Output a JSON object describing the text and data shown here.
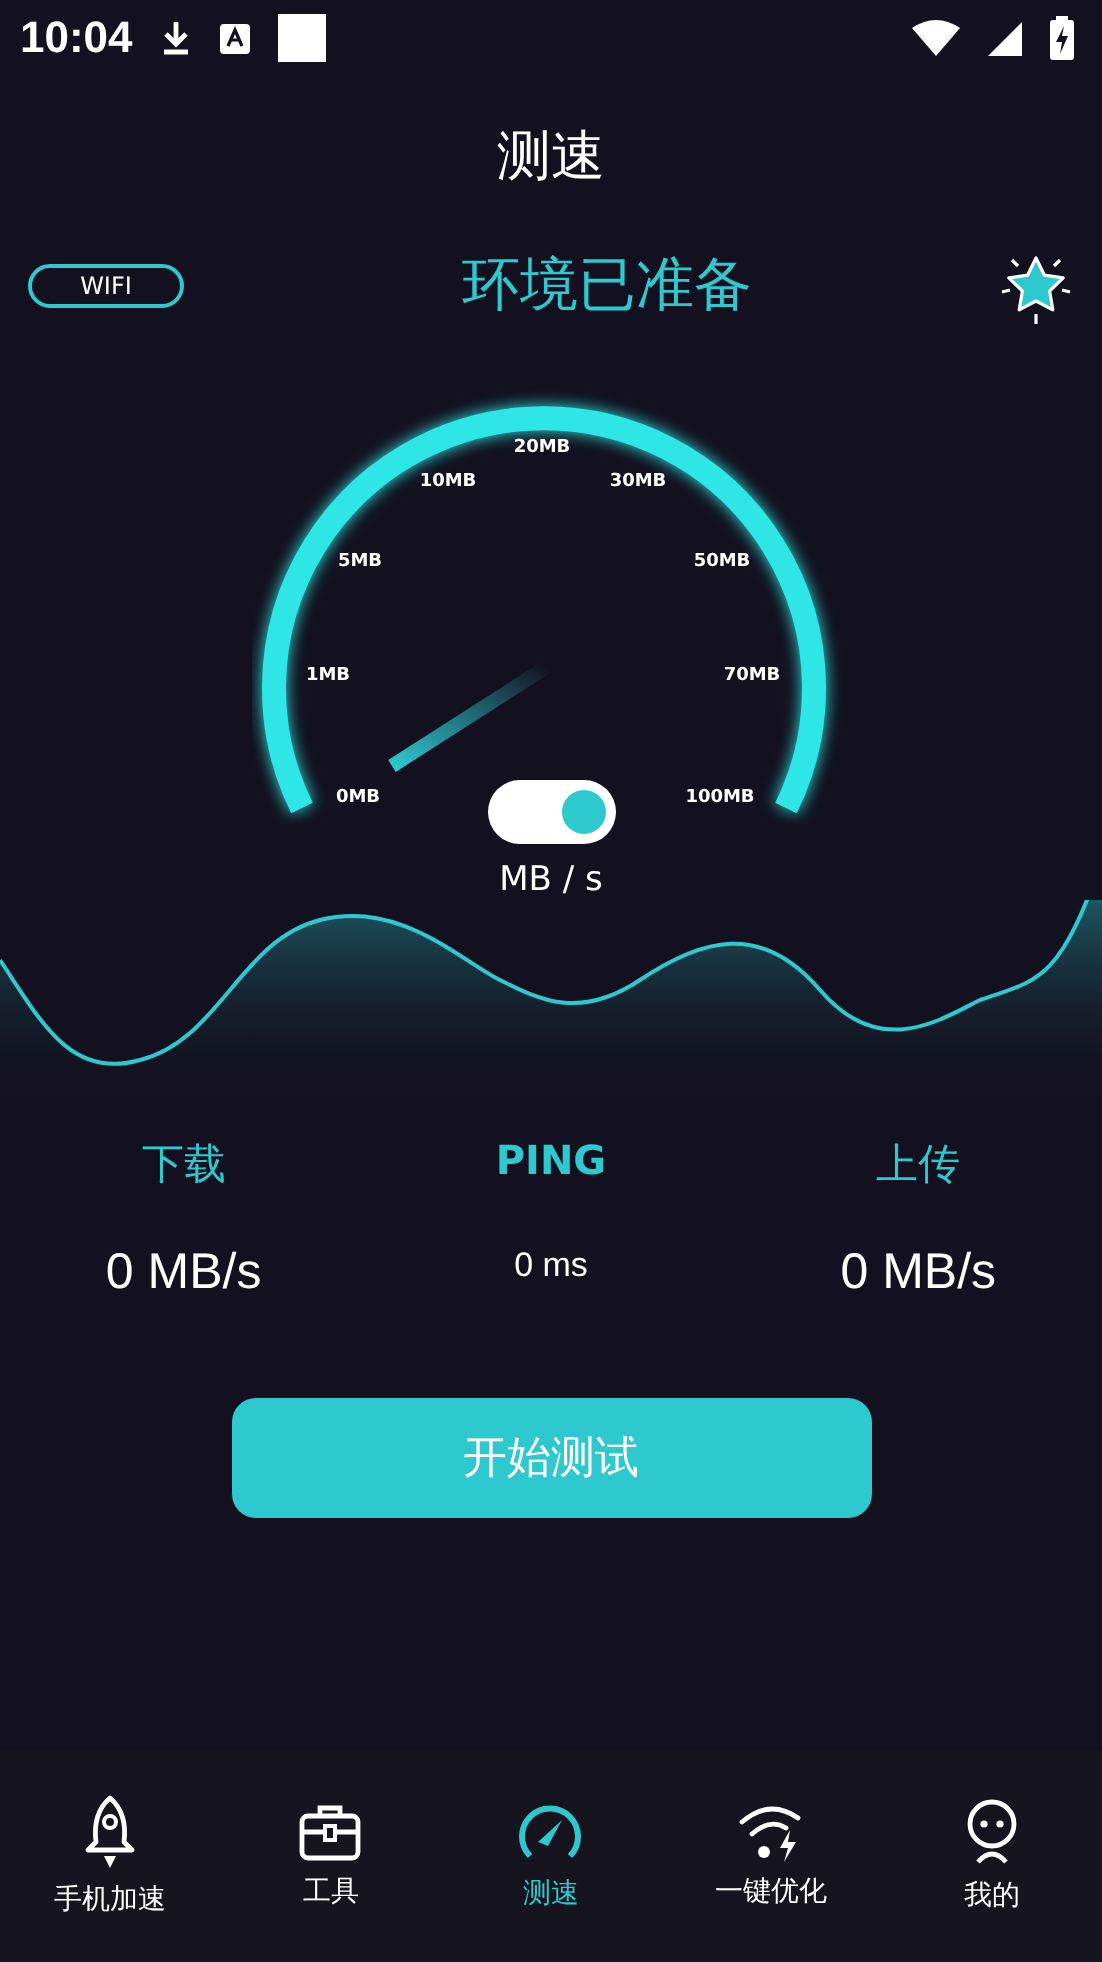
{
  "status_bar": {
    "time": "10:04"
  },
  "title": "测速",
  "network_badge": "WIFI",
  "status_text": "环境已准备",
  "gauge": {
    "labels": [
      "0MB",
      "1MB",
      "5MB",
      "10MB",
      "20MB",
      "30MB",
      "50MB",
      "70MB",
      "100MB"
    ],
    "unit_toggle": {
      "on": true
    },
    "unit": "MB / s"
  },
  "stats": [
    {
      "kind": "speed",
      "label": "下载",
      "value": "0 MB/s"
    },
    {
      "kind": "latency",
      "label": "PING",
      "value": "0 ms"
    },
    {
      "kind": "speed",
      "label": "上传",
      "value": "0 MB/s"
    }
  ],
  "start_button": "开始测试",
  "nav": [
    {
      "kind": "rocket",
      "label": "手机加速",
      "selected": false
    },
    {
      "kind": "toolbox",
      "label": "工具",
      "selected": false
    },
    {
      "kind": "gauge",
      "label": "测速",
      "selected": true
    },
    {
      "kind": "wifi",
      "label": "一键优化",
      "selected": false
    },
    {
      "kind": "person",
      "label": "我的",
      "selected": false
    }
  ]
}
